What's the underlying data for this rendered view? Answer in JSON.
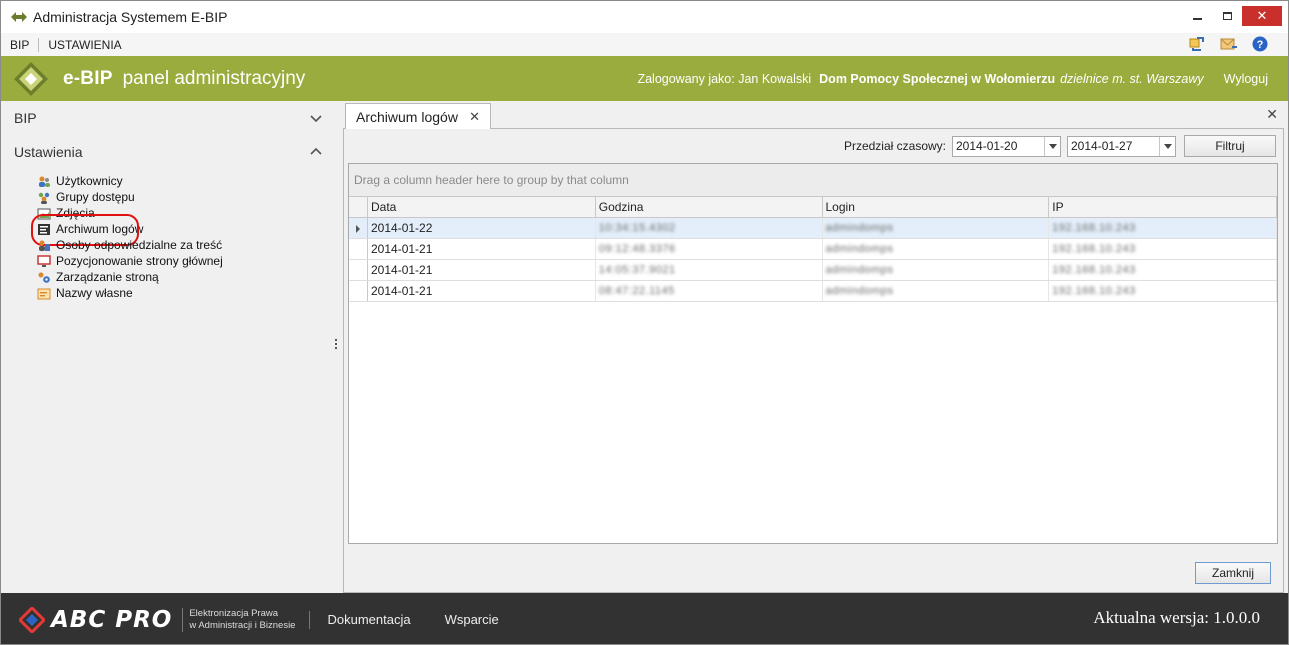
{
  "window": {
    "title": "Administracja Systemem E-BIP",
    "close_glyph": "✕"
  },
  "menu": {
    "items": [
      "BIP",
      "USTAWIENIA"
    ],
    "right_icons": [
      "sync-icon",
      "mail-icon",
      "help-icon"
    ],
    "help_glyph": "?"
  },
  "header": {
    "brand": "e-BIP",
    "subtitle": "panel administracyjny",
    "logged_as": "Zalogowany jako: Jan Kowalski",
    "organization": "Dom Pomocy Społecznej w Wołomierzu",
    "district": "dzielnice m. st. Warszawy",
    "logout": "Wyloguj",
    "accent_color": "#9aac3e"
  },
  "sidebar": {
    "groups": [
      {
        "label": "BIP",
        "expanded": false
      },
      {
        "label": "Ustawienia",
        "expanded": true
      }
    ],
    "items": [
      {
        "label": "Użytkownicy",
        "icon": "users-icon"
      },
      {
        "label": "Grupy dostępu",
        "icon": "group-icon"
      },
      {
        "label": "Zdjęcia",
        "icon": "image-icon"
      },
      {
        "label": "Archiwum logów",
        "icon": "log-archive-icon",
        "active": true
      },
      {
        "label": "Osoby odpowiedzialne za treść",
        "icon": "responsible-person-icon"
      },
      {
        "label": "Pozycjonowanie strony głównej",
        "icon": "monitor-icon"
      },
      {
        "label": "Zarządzanie stroną",
        "icon": "site-settings-icon"
      },
      {
        "label": "Nazwy własne",
        "icon": "names-icon"
      }
    ]
  },
  "tab": {
    "label": "Archiwum logów",
    "close_glyph": "✕",
    "panel_close_glyph": "✕"
  },
  "filter": {
    "label": "Przedział czasowy:",
    "date_from": "2014-01-20",
    "date_to": "2014-01-27",
    "button": "Filtruj"
  },
  "grid": {
    "group_hint": "Drag a column header here to group by that column",
    "columns": [
      "Data",
      "Godzina",
      "Login",
      "IP"
    ],
    "rows": [
      {
        "data": "2014-01-22",
        "godzina": "10:34:15.4302",
        "login": "admindomps",
        "ip": "192.168.10.243"
      },
      {
        "data": "2014-01-21",
        "godzina": "09:12:48.3376",
        "login": "admindomps",
        "ip": "192.168.10.243"
      },
      {
        "data": "2014-01-21",
        "godzina": "14:05:37.9021",
        "login": "admindomps",
        "ip": "192.168.10.243"
      },
      {
        "data": "2014-01-21",
        "godzina": "08:47:22.1145",
        "login": "admindomps",
        "ip": "192.168.10.243"
      }
    ]
  },
  "buttons": {
    "close": "Zamknij"
  },
  "footer": {
    "logo_text": "ABC PRO",
    "tagline_1": "Elektronizacja Prawa",
    "tagline_2": "w Administracji i Biznesie",
    "links": [
      "Dokumentacja",
      "Wsparcie"
    ],
    "version": "Aktualna wersja: 1.0.0.0"
  }
}
